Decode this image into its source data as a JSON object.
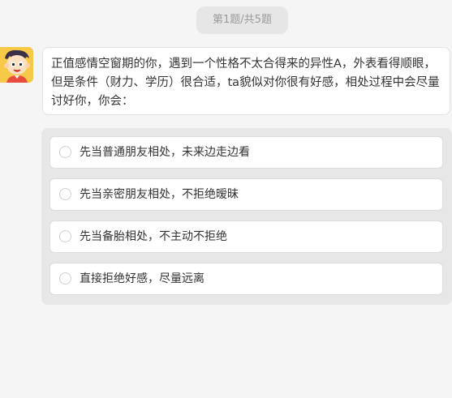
{
  "progress": {
    "label": "第1题/共5题"
  },
  "question": {
    "text": "正值感情空窗期的你，遇到一个性格不太合得来的异性A，外表看得顺眼，但是条件（财力、学历）很合适，ta貌似对你很有好感，相处过程中会尽量讨好你，你会："
  },
  "options": [
    {
      "label": "先当普通朋友相处，未来边走边看"
    },
    {
      "label": "先当亲密朋友相处，不拒绝暧昧"
    },
    {
      "label": "先当备胎相处，不主动不拒绝"
    },
    {
      "label": "直接拒绝好感，尽量远离"
    }
  ],
  "colors": {
    "background": "#f5f5f5",
    "options_panel": "#e7e7e7",
    "avatar_bg": "#f7c948"
  }
}
